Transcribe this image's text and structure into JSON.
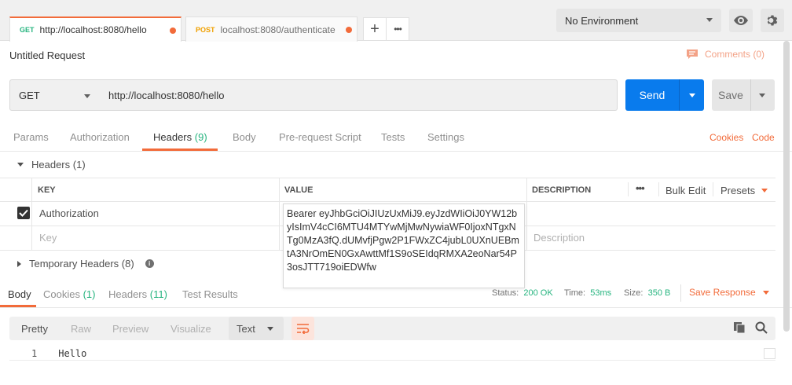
{
  "tabs": [
    {
      "method": "GET",
      "url": "http://localhost:8080/hello",
      "method_color": "#26b47f"
    },
    {
      "method": "POST",
      "url": "localhost:8080/authenticate",
      "method_color": "#f0a000"
    }
  ],
  "tab_actions": {
    "new_tab": "+",
    "more": "•••"
  },
  "environment": {
    "selected": "No Environment"
  },
  "request": {
    "name": "Untitled Request",
    "comments": "Comments (0)",
    "method": "GET",
    "url": "http://localhost:8080/hello",
    "send_label": "Send",
    "save_label": "Save"
  },
  "request_tabs": {
    "params": "Params",
    "authorization": "Authorization",
    "headers": "Headers",
    "headers_count": "(9)",
    "body": "Body",
    "pre_request": "Pre-request Script",
    "tests": "Tests",
    "settings": "Settings",
    "cookies": "Cookies",
    "code": "Code"
  },
  "headers_section": {
    "title": "Headers",
    "count": "(1)",
    "columns": {
      "key": "KEY",
      "value": "VALUE",
      "description": "DESCRIPTION"
    },
    "more": "•••",
    "bulk_edit": "Bulk Edit",
    "presets": "Presets",
    "rows": [
      {
        "checked": true,
        "key": "Authorization",
        "value": "Bearer eyJhbGciOiJIUzUxMiJ9.eyJzdWIiOiJ0YW12byIsImV4cCI6MTU4MTYwMjMwNywiaWF0IjoxNTgxNTg0MzA3fQ.dUMvfjPgw2P1FWxZC4jubL0UXnUEBmtA3NrOmEN0GxAwttMf1S9oSEIdqRMXA2eoNar54P3osJTT719oiEDWfw"
      }
    ],
    "placeholder_key": "Key",
    "placeholder_description": "Description",
    "temporary_title": "Temporary Headers",
    "temporary_count": "(8)"
  },
  "response": {
    "tabs": {
      "body": "Body",
      "cookies": "Cookies",
      "cookies_count": "(1)",
      "headers": "Headers",
      "headers_count": "(11)",
      "test_results": "Test Results"
    },
    "status_label": "Status:",
    "status_value": "200 OK",
    "time_label": "Time:",
    "time_value": "53ms",
    "size_label": "Size:",
    "size_value": "350 B",
    "save_response": "Save Response",
    "modes": [
      "Pretty",
      "Raw",
      "Preview",
      "Visualize"
    ],
    "format": "Text",
    "line_number": "1",
    "body_text": "Hello"
  },
  "colors": {
    "accent": "#f26b3a",
    "send": "#097bed",
    "status_ok": "#26b47f"
  }
}
